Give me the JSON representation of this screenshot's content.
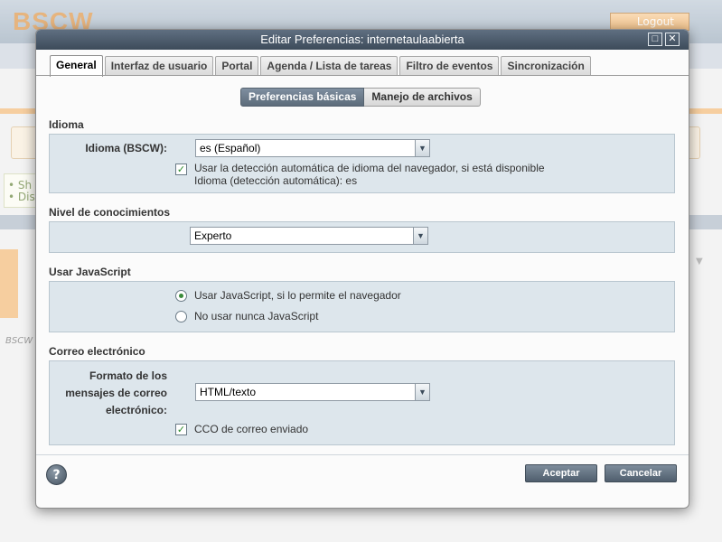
{
  "background": {
    "logo": "BSCW",
    "logout_label": "Logout",
    "bullets": [
      "Sh",
      "Dis"
    ],
    "caption": "BSCW"
  },
  "dialog": {
    "title": "Editar Preferencias: internetaulaabierta",
    "window_buttons": {
      "maximize": "□",
      "close": "✕"
    },
    "tabs": [
      {
        "label": "General",
        "active": true
      },
      {
        "label": "Interfaz de usuario"
      },
      {
        "label": "Portal"
      },
      {
        "label": "Agenda / Lista de tareas"
      },
      {
        "label": "Filtro de eventos"
      },
      {
        "label": "Sincronización"
      }
    ],
    "subtabs": [
      {
        "label": "Preferencias básicas",
        "active": true
      },
      {
        "label": "Manejo de archivos"
      }
    ],
    "sections": {
      "idioma": {
        "title": "Idioma",
        "field_label": "Idioma (BSCW):",
        "select_value": "es (Español)",
        "checkbox_checked": true,
        "checkbox_label": "Usar la detección automática de idioma del navegador, si está disponible",
        "detected_text": "Idioma (detección automática): es"
      },
      "nivel": {
        "title": "Nivel de conocimientos",
        "select_value": "Experto"
      },
      "javascript": {
        "title": "Usar JavaScript",
        "options": [
          {
            "label": "Usar JavaScript, si lo permite el navegador",
            "selected": true
          },
          {
            "label": "No usar nunca JavaScript",
            "selected": false
          }
        ]
      },
      "correo": {
        "title": "Correo electrónico",
        "field_label_lines": [
          "Formato de los",
          "mensajes de correo",
          "electrónico:"
        ],
        "select_value": "HTML/texto",
        "checkbox_checked": true,
        "checkbox_label": "CCO de correo enviado"
      }
    },
    "footer": {
      "help_label": "?",
      "accept_label": "Aceptar",
      "cancel_label": "Cancelar"
    }
  },
  "colors": {
    "titlebar": "#4d5b6a",
    "section_bg": "#dde6ec",
    "check_color": "#2a8a2a"
  }
}
